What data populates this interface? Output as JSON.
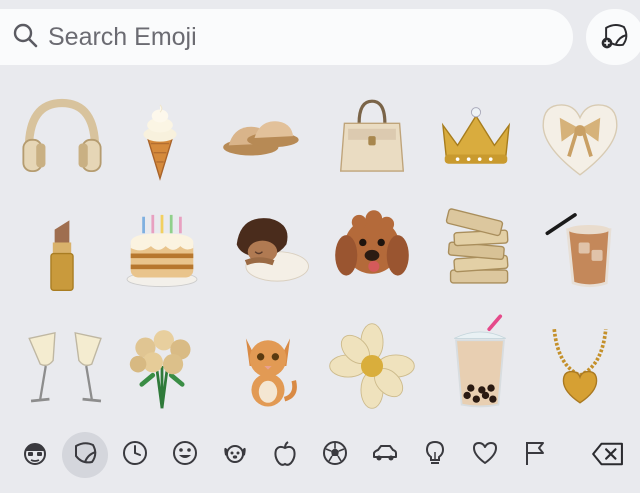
{
  "search": {
    "placeholder": "Search Emoji"
  },
  "sticker_button": {
    "icon": "sticker-add-icon"
  },
  "emoji_grid": {
    "rows": [
      [
        "headphones",
        "soft-ice-cream",
        "slippers",
        "handbag",
        "crown",
        "heart-with-ribbon"
      ],
      [
        "lipstick",
        "birthday-cake",
        "sleeping-person",
        "dog-face",
        "books",
        "iced-coffee"
      ],
      [
        "clinking-glasses",
        "bouquet",
        "cat",
        "blossom",
        "bubble-tea",
        "heart-necklace"
      ]
    ]
  },
  "category_bar": {
    "items": [
      {
        "icon": "memoji-face-icon",
        "active": false
      },
      {
        "icon": "sticker-icon",
        "active": true
      },
      {
        "icon": "clock-icon",
        "active": false
      },
      {
        "icon": "smiley-icon",
        "active": false
      },
      {
        "icon": "dog-icon",
        "active": false
      },
      {
        "icon": "apple-icon",
        "active": false
      },
      {
        "icon": "soccer-ball-icon",
        "active": false
      },
      {
        "icon": "car-icon",
        "active": false
      },
      {
        "icon": "lightbulb-icon",
        "active": false
      },
      {
        "icon": "heart-icon",
        "active": false
      },
      {
        "icon": "flag-icon",
        "active": false
      }
    ],
    "delete_icon": "backspace-icon"
  },
  "colors": {
    "background": "#e9eaee",
    "search_field": "#fafbfc",
    "icon_stroke": "#3a3a3f",
    "active_category": "#d4d6dc"
  }
}
